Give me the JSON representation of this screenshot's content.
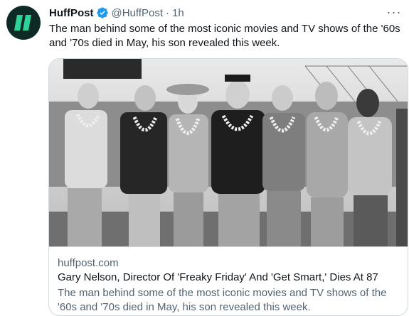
{
  "tweet": {
    "author_name": "HuffPost",
    "handle": "@HuffPost",
    "separator": "·",
    "time": "1h",
    "more_label": "···",
    "text": "The man behind some of the most iconic movies and TV shows of the '60s and '70s died in May, his son revealed this week.",
    "avatar_icon": "huffpost-logo-icon",
    "verified_icon": "verified-badge-icon",
    "colors": {
      "avatar_bg": "#0e2a24",
      "logo_green": "#2ed39a",
      "verified_blue": "#1d9bf0",
      "text_primary": "#0f1419",
      "text_secondary": "#536471",
      "border": "#cfd9de"
    }
  },
  "card": {
    "image_description_icon": "photo",
    "domain": "huffpost.com",
    "title": "Gary Nelson, Director Of 'Freaky Friday' And 'Get Smart,' Dies At 87",
    "description": "The man behind some of the most iconic movies and TV shows of the '60s and '70s died in May, his son revealed this week."
  }
}
